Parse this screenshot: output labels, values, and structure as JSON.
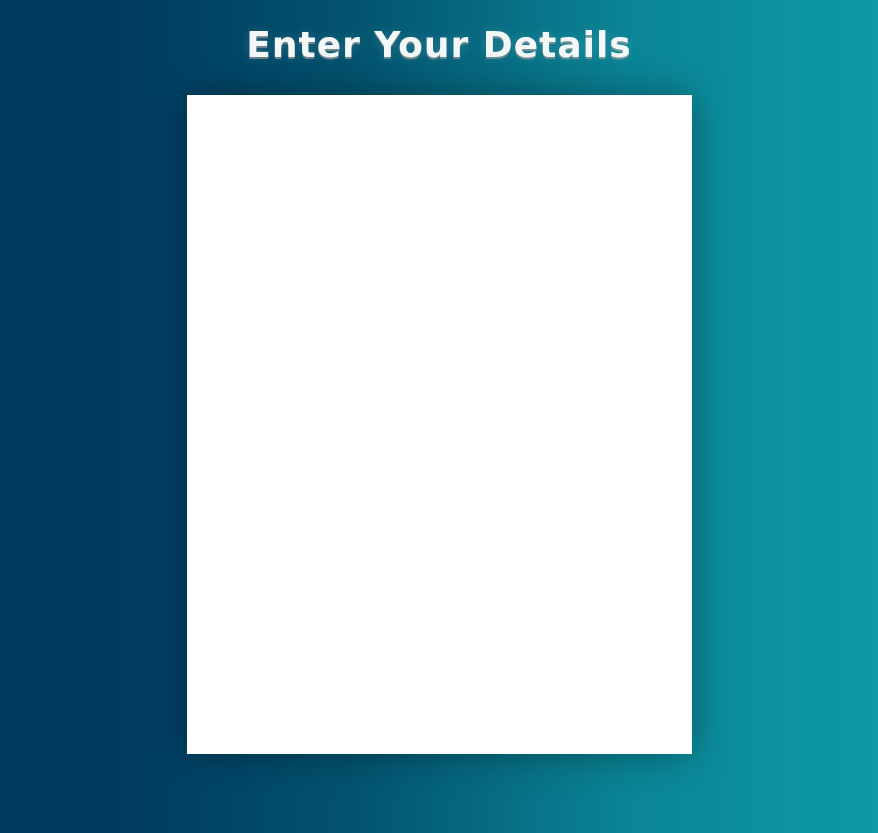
{
  "header": {
    "title": "Enter Your Details"
  },
  "form": {
    "fields": []
  },
  "colors": {
    "background_left": "#003a5f",
    "background_right": "#0d99a8",
    "card": "#ffffff",
    "title_text": "#f4f7f8"
  }
}
